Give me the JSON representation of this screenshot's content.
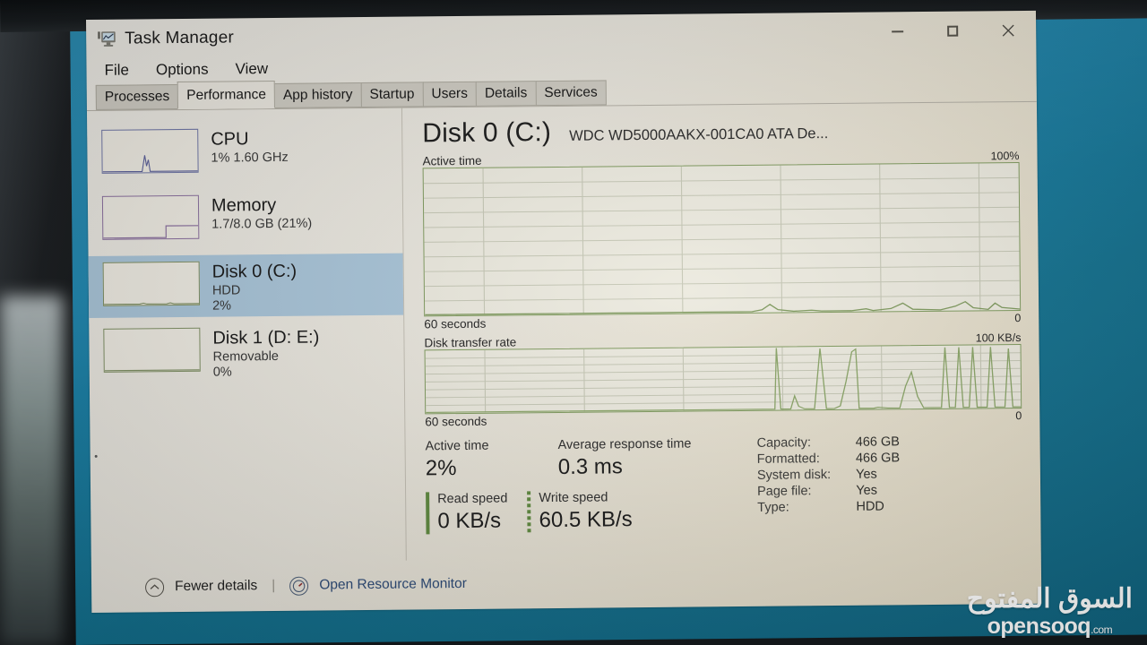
{
  "window": {
    "title": "Task Manager",
    "icon": "task-manager-icon",
    "controls": {
      "minimize": "—",
      "maximize": "□",
      "close": "✕"
    }
  },
  "menubar": {
    "items": [
      "File",
      "Options",
      "View"
    ]
  },
  "tabs": {
    "items": [
      "Processes",
      "Performance",
      "App history",
      "Startup",
      "Users",
      "Details",
      "Services"
    ],
    "active": "Performance"
  },
  "sidebar": {
    "items": [
      {
        "name": "CPU",
        "line2": "1%  1.60 GHz",
        "line3": "",
        "selected": false
      },
      {
        "name": "Memory",
        "line2": "1.7/8.0 GB (21%)",
        "line3": "",
        "selected": false
      },
      {
        "name": "Disk 0 (C:)",
        "line2": "HDD",
        "line3": "2%",
        "selected": true
      },
      {
        "name": "Disk 1 (D: E:)",
        "line2": "Removable",
        "line3": "0%",
        "selected": false
      }
    ]
  },
  "main": {
    "title": "Disk 0 (C:)",
    "subtitle": "WDC WD5000AAKX-001CA0 ATA De...",
    "active_time_graph": {
      "label": "Active time",
      "max_label": "100%",
      "min_label": "0",
      "duration_label": "60 seconds"
    },
    "transfer_rate_graph": {
      "label": "Disk transfer rate",
      "max_label": "100 KB/s",
      "min_label": "0",
      "duration_label": "60 seconds"
    },
    "stats": [
      {
        "label": "Active time",
        "value": "2%"
      },
      {
        "label": "Average response time",
        "value": "0.3 ms"
      }
    ],
    "speeds": [
      {
        "label": "Read speed",
        "value": "0 KB/s",
        "marker": "solid"
      },
      {
        "label": "Write speed",
        "value": "60.5 KB/s",
        "marker": "dotted"
      }
    ],
    "info": [
      {
        "label": "Capacity:",
        "value": "466 GB"
      },
      {
        "label": "Formatted:",
        "value": "466 GB"
      },
      {
        "label": "System disk:",
        "value": "Yes"
      },
      {
        "label": "Page file:",
        "value": "Yes"
      },
      {
        "label": "Type:",
        "value": "HDD"
      }
    ]
  },
  "footer": {
    "fewer_details": "Fewer details",
    "separator": "|",
    "open_resource_monitor": "Open Resource Monitor",
    "chevron_icon": "chevron-up-icon",
    "resource_icon": "resource-monitor-icon"
  },
  "watermark": {
    "arabic": "السوق المفتوح",
    "brand": "opensooq",
    "tld": ".com"
  },
  "colors": {
    "graph_line": "#7f9a5e",
    "selection": "#a9c5d9",
    "desktop": "#1b84ad",
    "window_bg": "#eceae4"
  },
  "chart_data": [
    {
      "type": "line",
      "title": "Active time",
      "ylabel": "%",
      "xlabel": "60 seconds",
      "ylim": [
        0,
        100
      ],
      "grid": true,
      "x": [
        0,
        2,
        4,
        6,
        8,
        10,
        12,
        14,
        16,
        18,
        20,
        22,
        24,
        26,
        28,
        30,
        32,
        34,
        36,
        38,
        40,
        42,
        44,
        46,
        48,
        50,
        52,
        54,
        56,
        58,
        60
      ],
      "values": [
        0,
        0,
        0,
        0,
        0,
        0,
        0,
        0,
        0,
        0,
        0,
        0,
        0,
        0,
        0,
        0,
        0,
        0,
        1,
        2,
        3,
        1,
        0,
        1,
        0,
        0,
        1,
        4,
        2,
        0,
        1,
        3,
        2,
        0,
        1,
        4,
        2,
        0
      ]
    },
    {
      "type": "line",
      "title": "Disk transfer rate",
      "ylabel": "KB/s",
      "xlabel": "60 seconds",
      "ylim": [
        0,
        100
      ],
      "grid": true,
      "x": [
        0,
        2,
        4,
        6,
        8,
        10,
        12,
        14,
        16,
        18,
        20,
        22,
        24,
        26,
        28,
        30,
        32,
        34,
        36,
        38,
        40,
        42,
        44,
        46,
        48,
        50,
        52,
        54,
        56,
        58,
        60
      ],
      "values": [
        0,
        0,
        0,
        0,
        0,
        0,
        0,
        0,
        0,
        0,
        0,
        0,
        0,
        0,
        0,
        0,
        0,
        0,
        0,
        0,
        0,
        0,
        100,
        2,
        30,
        0,
        4,
        60,
        5,
        100,
        12,
        0,
        100,
        4,
        0,
        55,
        3,
        100,
        100,
        100,
        96
      ]
    }
  ]
}
